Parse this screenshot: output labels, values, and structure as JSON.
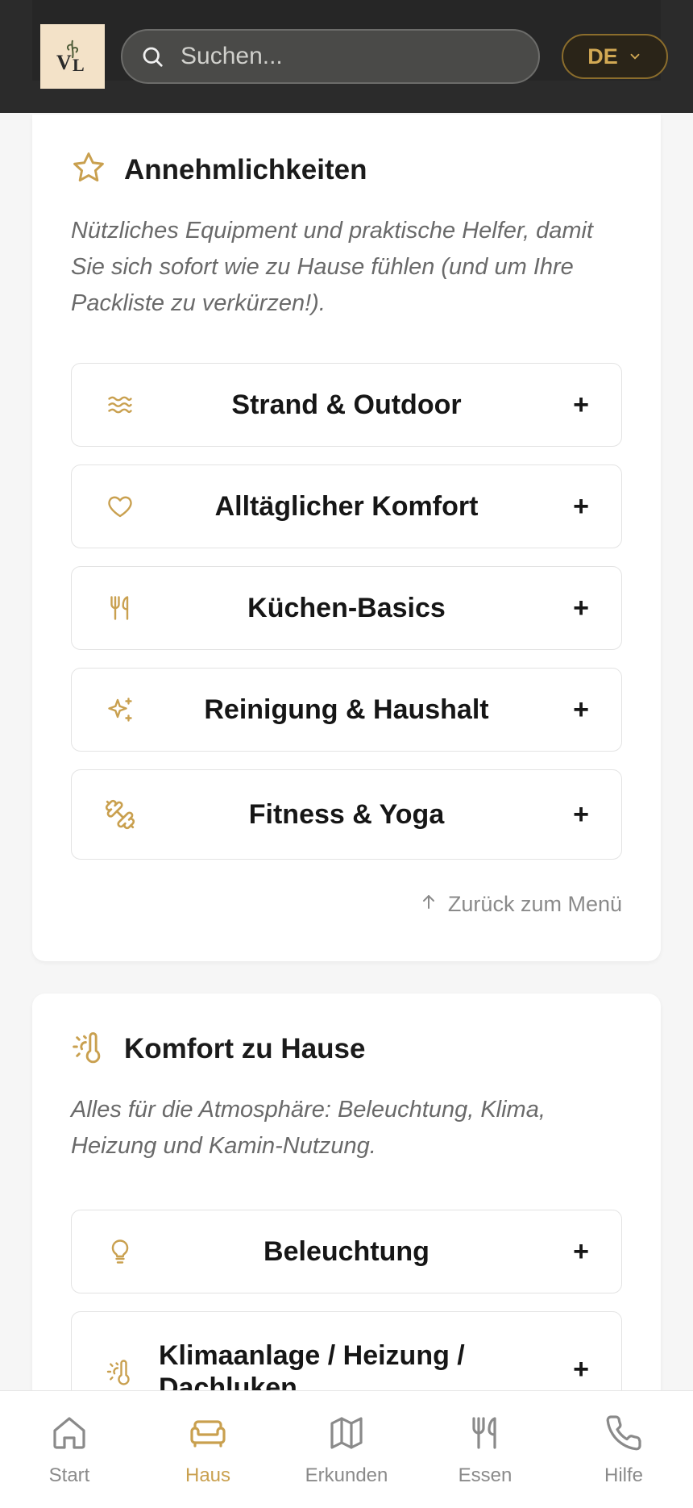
{
  "header": {
    "logo_text": "VL",
    "search_placeholder": "Suchen...",
    "language": "DE"
  },
  "colors": {
    "accent": "#c9a04f",
    "header_bg": "#2b2b2b"
  },
  "amenities": {
    "title": "Annehmlichkeiten",
    "icon": "star-icon",
    "description": "Nützliches Equipment und praktische Helfer, damit Sie sich sofort wie zu Hause fühlen (und um Ihre Packliste zu verkürzen!).",
    "items": [
      {
        "label": "Strand & Outdoor",
        "icon": "waves-icon",
        "toggle": "+"
      },
      {
        "label": "Alltäglicher Komfort",
        "icon": "heart-icon",
        "toggle": "+"
      },
      {
        "label": "Küchen-Basics",
        "icon": "utensils-icon",
        "toggle": "+"
      },
      {
        "label": "Reinigung & Haushalt",
        "icon": "sparkles-icon",
        "toggle": "+"
      },
      {
        "label": "Fitness & Yoga",
        "icon": "dumbbell-icon",
        "toggle": "+"
      }
    ],
    "back_link": "Zurück zum Menü"
  },
  "comfort": {
    "title": "Komfort zu Hause",
    "icon": "thermometer-sun-icon",
    "description": "Alles für die Atmosphäre: Beleuchtung, Klima, Heizung und Kamin-Nutzung.",
    "items": [
      {
        "label": "Beleuchtung",
        "icon": "lightbulb-icon",
        "toggle": "+"
      },
      {
        "label": "Klimaanlage / Heizung / Dachluken",
        "icon": "thermometer-sun-icon",
        "toggle": "+"
      }
    ]
  },
  "bottom_nav": [
    {
      "label": "Start",
      "icon": "home-icon",
      "active": false
    },
    {
      "label": "Haus",
      "icon": "sofa-icon",
      "active": true
    },
    {
      "label": "Erkunden",
      "icon": "map-icon",
      "active": false
    },
    {
      "label": "Essen",
      "icon": "utensils-icon",
      "active": false
    },
    {
      "label": "Hilfe",
      "icon": "phone-icon",
      "active": false
    }
  ]
}
